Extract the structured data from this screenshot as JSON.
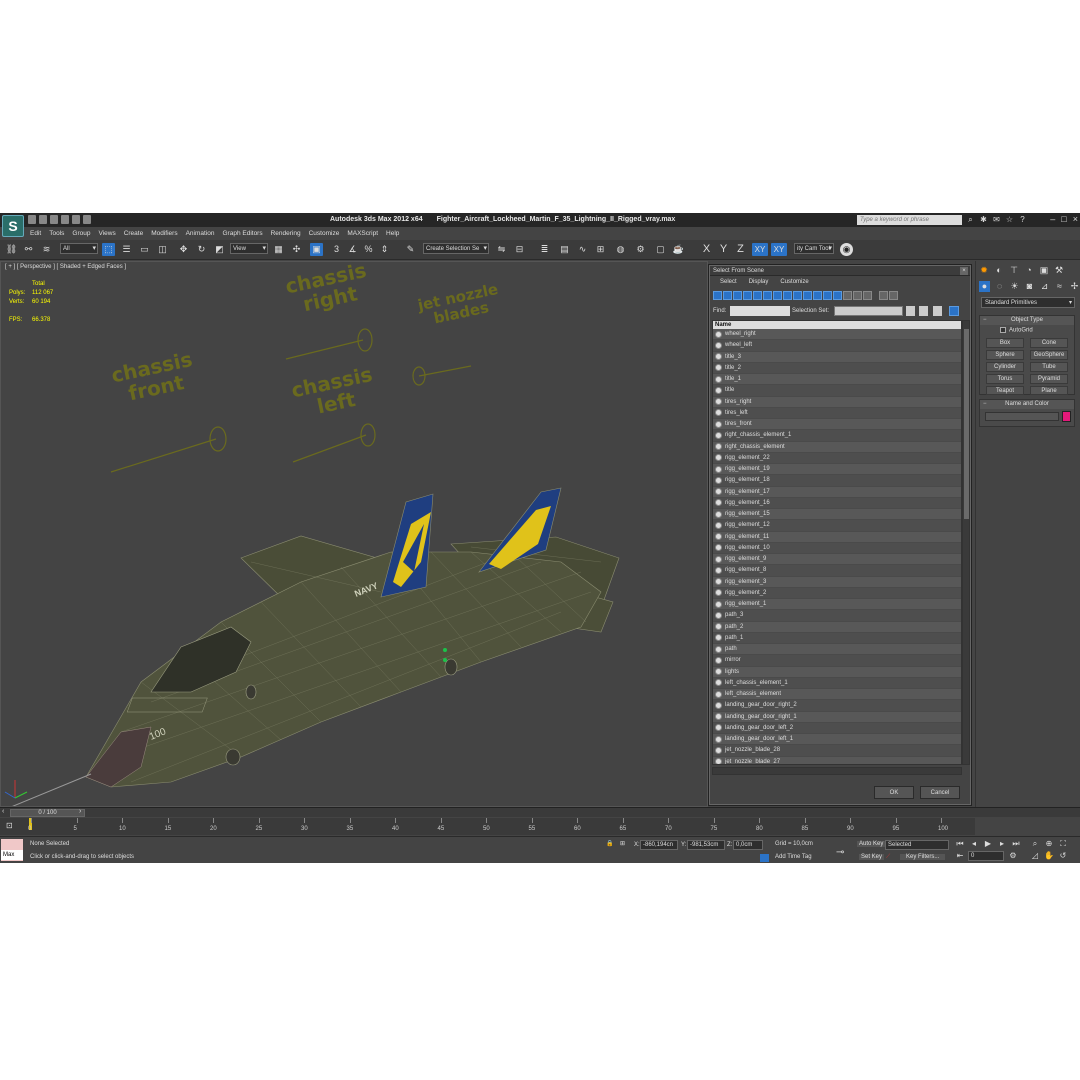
{
  "app": {
    "title": "Autodesk 3ds Max  2012 x64",
    "file": "Fighter_Aircraft_Lockheed_Martin_F_35_Lightning_II_Rigged_vray.max",
    "logo": "S",
    "search_placeholder": "Type a keyword or phrase"
  },
  "menu": [
    "Edit",
    "Tools",
    "Group",
    "Views",
    "Create",
    "Modifiers",
    "Animation",
    "Graph Editors",
    "Rendering",
    "Customize",
    "MAXScript",
    "Help"
  ],
  "toolbar": {
    "filter_value": "All",
    "refcoord_value": "View",
    "selection_set_value": "Create Selection Se",
    "x_label": "X",
    "y_label": "Y",
    "z_label": "Z",
    "xy_label": "XY",
    "xy2_label": "XY",
    "city_label": "ity Cam Tool"
  },
  "viewport": {
    "label": "[ + ] [ Perspective ] [ Shaded + Edged Faces ]",
    "stats": {
      "total_label": "Total",
      "polys_label": "Polys:",
      "polys_value": "112 067",
      "verts_label": "Verts:",
      "verts_value": "60 194",
      "fps_label": "FPS:",
      "fps_value": "66.378"
    },
    "texts": {
      "chassis_front": "chassis\nfront",
      "chassis_right": "chassis\nright",
      "chassis_left": "chassis\nleft",
      "jet_nozzle": "jet nozzle\nblades"
    },
    "aircraft_marking": "NAVY",
    "tail_number": "100"
  },
  "command_panel": {
    "primitive_type": "Standard Primitives",
    "object_type_title": "Object Type",
    "autogrid": "AutoGrid",
    "buttons": [
      "Box",
      "Cone",
      "Sphere",
      "GeoSphere",
      "Cylinder",
      "Tube",
      "Torus",
      "Pyramid",
      "Teapot",
      "Plane"
    ],
    "name_color_title": "Name and Color",
    "color": "#e3197a"
  },
  "dialog": {
    "title": "Select From Scene",
    "menu": [
      "Select",
      "Display",
      "Customize"
    ],
    "find_label": "Find:",
    "selection_set_label": "Selection Set:",
    "name_header": "Name",
    "items": [
      "wheel_right",
      "wheel_left",
      "title_3",
      "title_2",
      "title_1",
      "title",
      "tires_right",
      "tires_left",
      "tires_front",
      "right_chassis_element_1",
      "right_chassis_element",
      "rigg_element_22",
      "rigg_element_19",
      "rigg_element_18",
      "rigg_element_17",
      "rigg_element_16",
      "rigg_element_15",
      "rigg_element_12",
      "rigg_element_11",
      "rigg_element_10",
      "rigg_element_9",
      "rigg_element_8",
      "rigg_element_3",
      "rigg_element_2",
      "rigg_element_1",
      "path_3",
      "path_2",
      "path_1",
      "path",
      "mirror",
      "lights",
      "left_chassis_element_1",
      "left_chassis_element",
      "landing_gear_door_right_2",
      "landing_gear_door_right_1",
      "landing_gear_door_left_2",
      "landing_gear_door_left_1",
      "jet_nozzle_blade_28",
      "jet_nozzle_blade_27",
      "jet_nozzle_blade_26"
    ],
    "ok": "OK",
    "cancel": "Cancel"
  },
  "timeline": {
    "slider": "0 / 100",
    "ticks": [
      "0",
      "5",
      "10",
      "15",
      "20",
      "25",
      "30",
      "35",
      "40",
      "45",
      "50",
      "55",
      "60",
      "65",
      "70",
      "75",
      "80",
      "85",
      "90",
      "95",
      "100"
    ]
  },
  "status": {
    "maxscript": "Max",
    "selection": "None Selected",
    "prompt": "Click or click-and-drag to select objects",
    "x_label": "X:",
    "x_value": "-860,194cn",
    "y_label": "Y:",
    "y_value": "-981,53cm",
    "z_label": "Z:",
    "z_value": "0,0cm",
    "grid": "Grid = 10,0cm",
    "add_time_tag": "Add Time Tag",
    "auto_key": "Auto Key",
    "set_key": "Set Key",
    "key_mode": "Selected",
    "key_filters": "Key Filters...",
    "frame": "0"
  }
}
